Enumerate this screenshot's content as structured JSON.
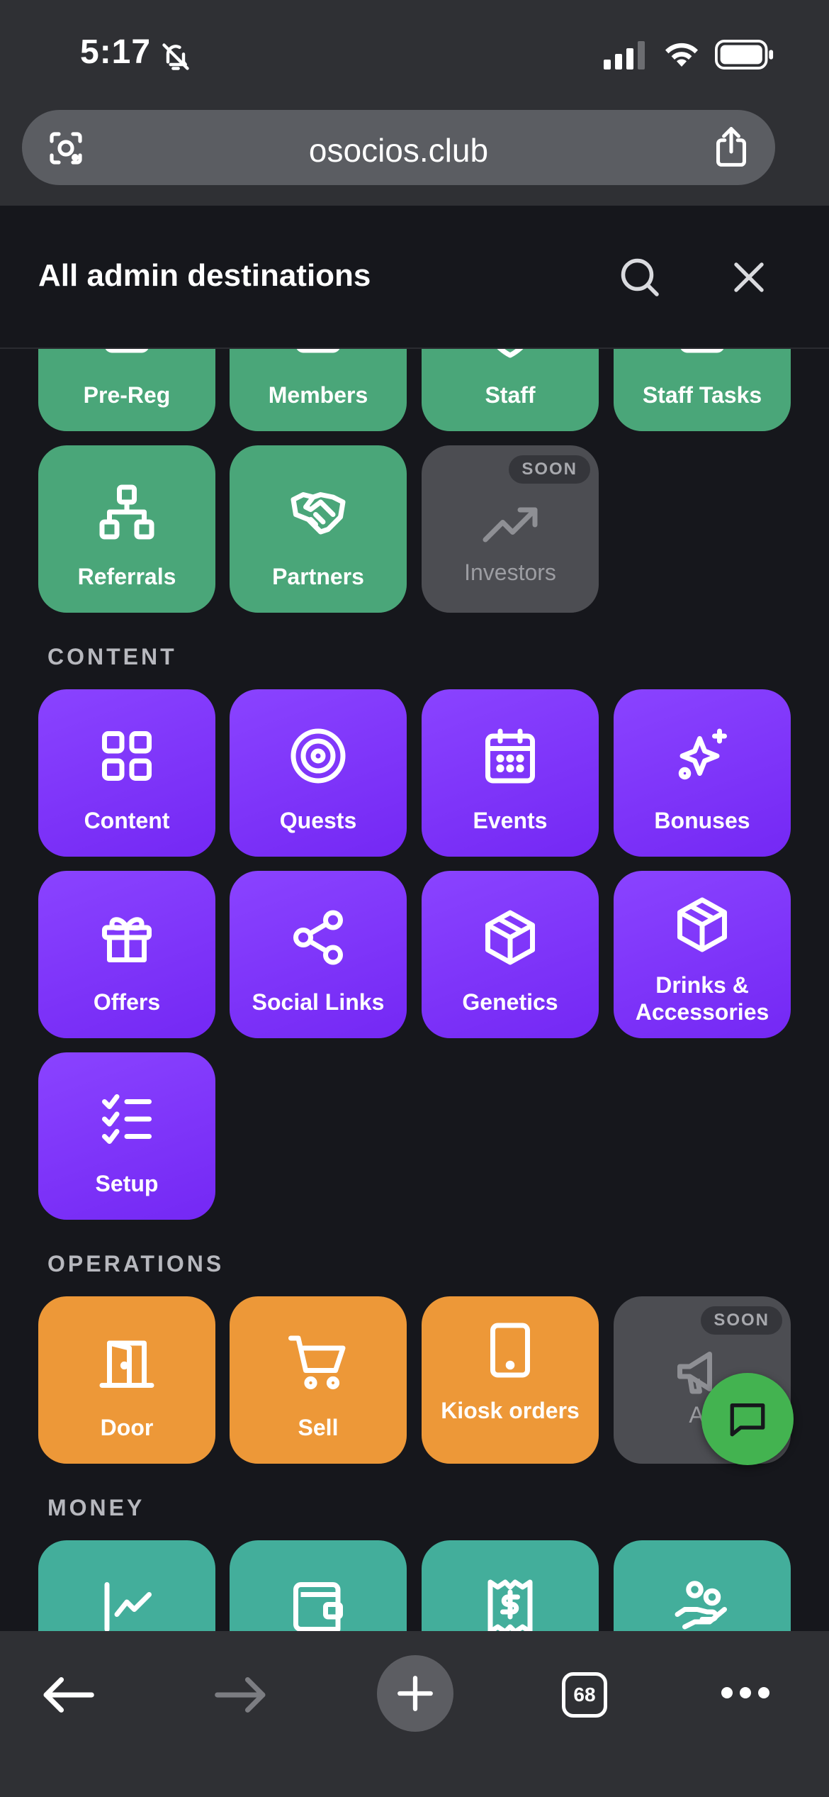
{
  "status_bar": {
    "time": "5:17"
  },
  "browser": {
    "url": "osocios.club",
    "tab_count": "68"
  },
  "header": {
    "title": "All admin destinations"
  },
  "sections": {
    "top": {
      "tiles": [
        {
          "label": "Pre-Reg",
          "icon": "pre-reg-icon"
        },
        {
          "label": "Members",
          "icon": "members-icon"
        },
        {
          "label": "Staff",
          "icon": "staff-icon"
        },
        {
          "label": "Staff Tasks",
          "icon": "staff-tasks-icon"
        },
        {
          "label": "Referrals",
          "icon": "referrals-icon"
        },
        {
          "label": "Partners",
          "icon": "handshake-icon"
        },
        {
          "label": "Investors",
          "icon": "trending-up-icon",
          "badge": "SOON"
        }
      ]
    },
    "content": {
      "title": "CONTENT",
      "tiles": [
        {
          "label": "Content",
          "icon": "grid-icon"
        },
        {
          "label": "Quests",
          "icon": "target-icon"
        },
        {
          "label": "Events",
          "icon": "calendar-icon"
        },
        {
          "label": "Bonuses",
          "icon": "sparkles-icon"
        },
        {
          "label": "Offers",
          "icon": "gift-icon"
        },
        {
          "label": "Social Links",
          "icon": "share-icon"
        },
        {
          "label": "Genetics",
          "icon": "box-icon"
        },
        {
          "label": "Drinks & Accessories",
          "icon": "box-icon"
        },
        {
          "label": "Setup",
          "icon": "checklist-icon"
        }
      ]
    },
    "operations": {
      "title": "OPERATIONS",
      "tiles": [
        {
          "label": "Door",
          "icon": "door-icon"
        },
        {
          "label": "Sell",
          "icon": "cart-icon"
        },
        {
          "label": "Kiosk orders",
          "icon": "tablet-icon"
        },
        {
          "label": "Ac",
          "icon": "megaphone-icon",
          "badge": "SOON"
        }
      ]
    },
    "money": {
      "title": "MONEY",
      "tiles": [
        {
          "icon": "chart-line-icon"
        },
        {
          "icon": "wallet-icon"
        },
        {
          "icon": "receipt-icon"
        },
        {
          "icon": "hand-coins-icon"
        }
      ]
    }
  },
  "colors": {
    "green": "#4aa679",
    "purple": "#7f35fb",
    "orange": "#ed9838",
    "teal": "#43ae9b",
    "disabled": "#4c4d52",
    "background": "#16171c",
    "chat_fab": "#43b350"
  }
}
